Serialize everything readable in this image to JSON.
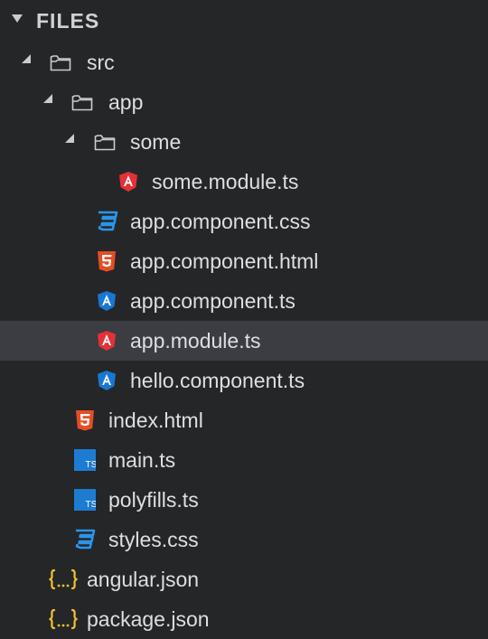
{
  "header": {
    "title": "FILES"
  },
  "tree": [
    {
      "label": "src",
      "icon": "folder-open-icon"
    },
    {
      "label": "app",
      "icon": "folder-open-icon"
    },
    {
      "label": "some",
      "icon": "folder-open-icon"
    },
    {
      "label": "some.module.ts",
      "icon": "angular-red-icon"
    },
    {
      "label": "app.component.css",
      "icon": "css-icon"
    },
    {
      "label": "app.component.html",
      "icon": "html5-icon"
    },
    {
      "label": "app.component.ts",
      "icon": "angular-blue-icon"
    },
    {
      "label": "app.module.ts",
      "icon": "angular-red-icon",
      "selected": true
    },
    {
      "label": "hello.component.ts",
      "icon": "angular-blue-icon"
    },
    {
      "label": "index.html",
      "icon": "html5-icon"
    },
    {
      "label": "main.ts",
      "icon": "typescript-icon"
    },
    {
      "label": "polyfills.ts",
      "icon": "typescript-icon"
    },
    {
      "label": "styles.css",
      "icon": "css-icon"
    },
    {
      "label": "angular.json",
      "icon": "json-icon"
    },
    {
      "label": "package.json",
      "icon": "json-icon"
    }
  ],
  "colors": {
    "background": "#252628",
    "selected": "#3b3d42",
    "angular_red": "#e23237",
    "angular_blue": "#1976d2",
    "css_blue": "#2196f3",
    "html_orange": "#e44d26",
    "ts_blue": "#1e7bd2",
    "json_yellow": "#f2c230"
  }
}
